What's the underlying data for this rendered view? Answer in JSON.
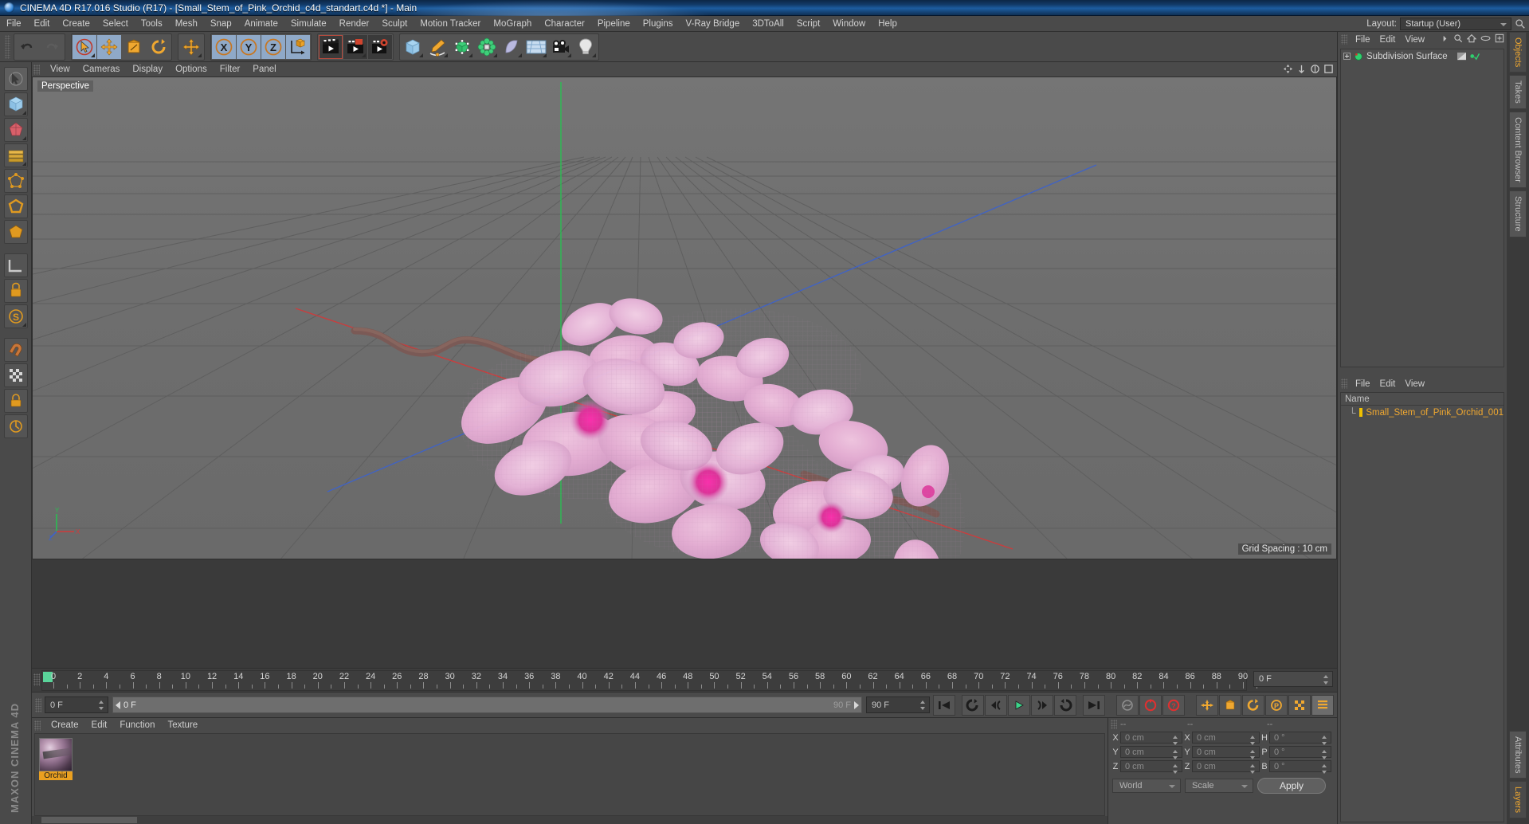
{
  "window": {
    "title": "CINEMA 4D R17.016 Studio (R17) - [Small_Stem_of_Pink_Orchid_c4d_standart.c4d *] - Main",
    "logo_icon": "cinema4d-logo-icon"
  },
  "menubar": {
    "items": [
      "File",
      "Edit",
      "Create",
      "Select",
      "Tools",
      "Mesh",
      "Snap",
      "Animate",
      "Simulate",
      "Render",
      "Sculpt",
      "Motion Tracker",
      "MoGraph",
      "Character",
      "Pipeline",
      "Plugins",
      "V-Ray Bridge",
      "3DToAll",
      "Script",
      "Window",
      "Help"
    ],
    "layout_label": "Layout:",
    "layout_value": "Startup (User)",
    "search_icon": "search-icon"
  },
  "toolbar": {
    "groups": [
      {
        "name": "history",
        "buttons": [
          {
            "icon": "undo-icon",
            "state": "normal"
          },
          {
            "icon": "redo-icon",
            "state": "disabled"
          }
        ]
      },
      {
        "name": "transform",
        "buttons": [
          {
            "icon": "select-arrow-icon",
            "state": "active-circle"
          },
          {
            "icon": "move-icon",
            "state": "active"
          },
          {
            "icon": "scale-icon",
            "state": "normal"
          },
          {
            "icon": "rotate-icon",
            "state": "normal"
          }
        ]
      },
      {
        "name": "move-alone",
        "buttons": [
          {
            "icon": "move-icon",
            "state": "normal"
          }
        ]
      },
      {
        "name": "axis-locks",
        "buttons": [
          {
            "icon": "x-axis-icon",
            "state": "active"
          },
          {
            "icon": "y-axis-icon",
            "state": "active"
          },
          {
            "icon": "z-axis-icon",
            "state": "active"
          },
          {
            "icon": "world-axis-icon",
            "state": "active"
          }
        ]
      },
      {
        "name": "render",
        "buttons": [
          {
            "icon": "render-view-icon",
            "state": "selected"
          },
          {
            "icon": "render-region-icon",
            "state": "normal"
          },
          {
            "icon": "render-settings-icon",
            "state": "normal"
          }
        ]
      },
      {
        "name": "primitives",
        "buttons": [
          {
            "icon": "cube-icon",
            "state": "normal"
          },
          {
            "icon": "spline-pen-icon",
            "state": "normal"
          },
          {
            "icon": "nurbs-icon",
            "state": "normal"
          },
          {
            "icon": "array-icon",
            "state": "normal"
          },
          {
            "icon": "deformer-icon",
            "state": "normal"
          },
          {
            "icon": "scene-icon",
            "state": "normal"
          },
          {
            "icon": "camera-icon",
            "state": "normal"
          },
          {
            "icon": "light-icon",
            "state": "normal"
          }
        ]
      }
    ],
    "right_icon": "render-queue-icon"
  },
  "left_palette": {
    "items": [
      "live-selection-icon",
      "cube-tool-icon",
      "polygon-pen-icon",
      "knife-icon",
      "point-mode-icon",
      "edge-mode-icon",
      "polygon-mode-icon",
      "model-mode-icon",
      "texture-mode-icon",
      "workplane-icon",
      "enable-axis-icon",
      "magnet-icon",
      "snap-icon",
      "lock-axis-icon"
    ],
    "brand": "MAXON CINEMA 4D"
  },
  "viewport": {
    "menu": [
      "View",
      "Cameras",
      "Display",
      "Options",
      "Filter",
      "Panel"
    ],
    "label": "Perspective",
    "grid_spacing": "Grid Spacing : 10 cm",
    "axis_labels": {
      "y": "Y",
      "x": "X",
      "z": "Z"
    },
    "nav_icons": [
      "pan-icon",
      "dolly-icon",
      "zoom-icon",
      "maximize-icon"
    ],
    "scene_object": "pink orchid stem mesh"
  },
  "timeline": {
    "ticks": [
      0,
      2,
      4,
      6,
      8,
      10,
      12,
      14,
      16,
      18,
      20,
      22,
      24,
      26,
      28,
      30,
      32,
      34,
      36,
      38,
      40,
      42,
      44,
      46,
      48,
      50,
      52,
      54,
      56,
      58,
      60,
      62,
      64,
      66,
      68,
      70,
      72,
      74,
      76,
      78,
      80,
      82,
      84,
      86,
      88,
      90
    ],
    "current_frame_label": "0 F",
    "playhead_frame": 0,
    "range_start": 0,
    "range_end": 90
  },
  "transport": {
    "start_field": "0 F",
    "range_left": "0 F",
    "range_right": "90 F",
    "end_field": "90 F",
    "buttons": [
      "go-to-start-icon",
      "play-backwards-icon",
      "step-back-icon",
      "play-forward-icon",
      "step-forward-icon",
      "play-loop-icon",
      "go-to-end-icon"
    ],
    "record_buttons": [
      "autokey-icon",
      "record-icon",
      "record-parameter-icon",
      "position-key-icon",
      "scale-key-icon",
      "rotation-key-icon",
      "param-key-icon",
      "pla-key-icon",
      "keyframe-selection-icon"
    ]
  },
  "material_manager": {
    "menu": [
      "Create",
      "Edit",
      "Function",
      "Texture"
    ],
    "materials": [
      {
        "name": "Orchid",
        "selected": true
      }
    ]
  },
  "coordinates": {
    "headers": [
      "--",
      "--",
      "--"
    ],
    "rows": [
      {
        "label1": "X",
        "value1": "0 cm",
        "label2": "X",
        "value2": "0 cm",
        "label3": "H",
        "value3": "0 °"
      },
      {
        "label1": "Y",
        "value1": "0 cm",
        "label2": "Y",
        "value2": "0 cm",
        "label3": "P",
        "value3": "0 °"
      },
      {
        "label1": "Z",
        "value1": "0 cm",
        "label2": "Z",
        "value2": "0 cm",
        "label3": "B",
        "value3": "0 °"
      }
    ],
    "system_select": "World",
    "mode_select": "Scale",
    "apply_label": "Apply"
  },
  "object_manager": {
    "menu": [
      "File",
      "Edit",
      "View"
    ],
    "icons": [
      "search-icon",
      "home-icon",
      "eye-icon",
      "filter-icon"
    ],
    "items": [
      {
        "label": "Subdivision Surface",
        "icon": "subdivision-surface-icon",
        "enabled": true
      }
    ]
  },
  "attributes_panel": {
    "menu": [
      "File",
      "Edit",
      "View"
    ],
    "column_header": "Name",
    "items": [
      {
        "label": "Small_Stem_of_Pink_Orchid_001",
        "color": "#f0c000"
      }
    ]
  },
  "side_tabs": {
    "top": [
      "Objects",
      "Takes",
      "Content Browser",
      "Structure"
    ],
    "bottom": [
      "Attributes",
      "Layers"
    ],
    "active_top": "Objects",
    "active_bottom": "Layers"
  },
  "colors": {
    "accent_orange": "#f0a830",
    "viewport_bg": "#6f6f6f",
    "panel_bg": "#4a4a4a",
    "axis_x": "#c0392b",
    "axis_y": "#27ae60",
    "axis_z": "#2e5bbd",
    "selection_green": "#5ad49a"
  }
}
